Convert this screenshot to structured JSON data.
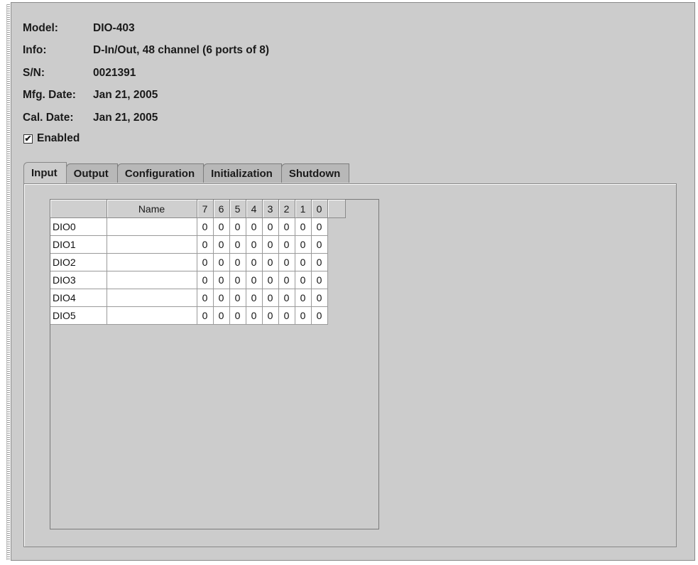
{
  "device": {
    "model_label": "Model:",
    "model": "DIO-403",
    "info_label": "Info:",
    "info": "D-In/Out, 48 channel (6 ports of 8)",
    "sn_label": "S/N:",
    "sn": "0021391",
    "mfg_label": "Mfg. Date:",
    "mfg_date": "Jan 21, 2005",
    "cal_label": "Cal. Date:",
    "cal_date": "Jan 21, 2005"
  },
  "enabled": {
    "label": "Enabled",
    "checked": true,
    "mark": "✔"
  },
  "tabs": [
    {
      "label": "Input",
      "active": true
    },
    {
      "label": "Output",
      "active": false
    },
    {
      "label": "Configuration",
      "active": false
    },
    {
      "label": "Initialization",
      "active": false
    },
    {
      "label": "Shutdown",
      "active": false
    }
  ],
  "table": {
    "header": {
      "device": "",
      "name": "Name",
      "bits": [
        "7",
        "6",
        "5",
        "4",
        "3",
        "2",
        "1",
        "0"
      ]
    },
    "rows": [
      {
        "device": "DIO0",
        "name": "",
        "bits": [
          "0",
          "0",
          "0",
          "0",
          "0",
          "0",
          "0",
          "0"
        ]
      },
      {
        "device": "DIO1",
        "name": "",
        "bits": [
          "0",
          "0",
          "0",
          "0",
          "0",
          "0",
          "0",
          "0"
        ]
      },
      {
        "device": "DIO2",
        "name": "",
        "bits": [
          "0",
          "0",
          "0",
          "0",
          "0",
          "0",
          "0",
          "0"
        ]
      },
      {
        "device": "DIO3",
        "name": "",
        "bits": [
          "0",
          "0",
          "0",
          "0",
          "0",
          "0",
          "0",
          "0"
        ]
      },
      {
        "device": "DIO4",
        "name": "",
        "bits": [
          "0",
          "0",
          "0",
          "0",
          "0",
          "0",
          "0",
          "0"
        ]
      },
      {
        "device": "DIO5",
        "name": "",
        "bits": [
          "0",
          "0",
          "0",
          "0",
          "0",
          "0",
          "0",
          "0"
        ]
      }
    ]
  }
}
